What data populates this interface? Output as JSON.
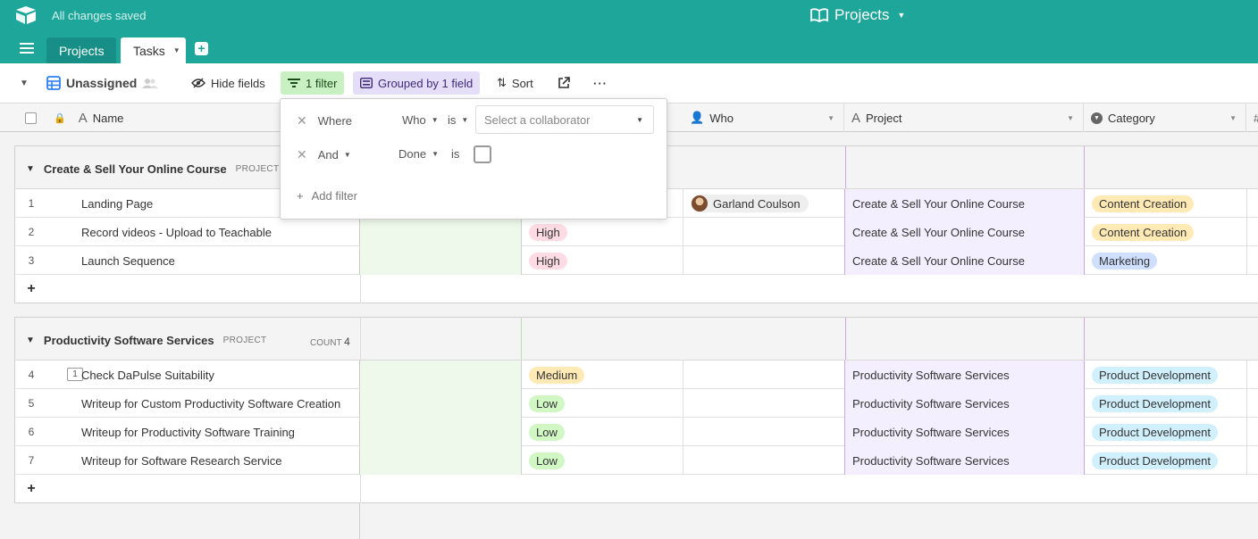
{
  "header": {
    "save_status": "All changes saved",
    "base_name": "Projects",
    "tabs": [
      {
        "label": "Projects"
      },
      {
        "label": "Tasks"
      }
    ],
    "accent_color": "#1ea69b"
  },
  "toolbar": {
    "view_name": "Unassigned",
    "hide_fields": "Hide fields",
    "filter": "1 filter",
    "group": "Grouped by 1 field",
    "sort": "Sort"
  },
  "columns": {
    "name": "Name",
    "who": "Who",
    "project": "Project",
    "category": "Category"
  },
  "filter_popup": {
    "row1": {
      "conjunction": "Where",
      "field": "Who",
      "operator": "is",
      "value_placeholder": "Select a collaborator"
    },
    "row2": {
      "conjunction": "And",
      "field": "Done",
      "operator": "is"
    },
    "add_filter": "Add filter"
  },
  "groups": [
    {
      "title": "Create & Sell Your Online Course",
      "kind": "PROJECT",
      "rows": [
        {
          "num": "1",
          "name": "Landing Page",
          "priority": "",
          "who": "Garland Coulson",
          "project": "Create & Sell Your Online Course",
          "category": "Content Creation"
        },
        {
          "num": "2",
          "name": "Record videos - Upload to Teachable",
          "priority": "High",
          "who": "",
          "project": "Create & Sell Your Online Course",
          "category": "Content Creation"
        },
        {
          "num": "3",
          "name": "Launch Sequence",
          "priority": "High",
          "who": "",
          "project": "Create & Sell Your Online Course",
          "category": "Marketing"
        }
      ]
    },
    {
      "title": "Productivity Software Services",
      "kind": "PROJECT",
      "count_label": "COUNT",
      "count": "4",
      "rows": [
        {
          "num": "4",
          "name": "Check DaPulse Suitability",
          "comments": "1",
          "priority": "Medium",
          "who": "",
          "project": "Productivity Software Services",
          "category": "Product Development"
        },
        {
          "num": "5",
          "name": "Writeup for Custom Productivity Software Creation",
          "priority": "Low",
          "who": "",
          "project": "Productivity Software Services",
          "category": "Product Development"
        },
        {
          "num": "6",
          "name": "Writeup for Productivity Software Training",
          "priority": "Low",
          "who": "",
          "project": "Productivity Software Services",
          "category": "Product Development"
        },
        {
          "num": "7",
          "name": "Writeup for Software Research Service",
          "priority": "Low",
          "who": "",
          "project": "Productivity Software Services",
          "category": "Product Development"
        }
      ]
    }
  ]
}
